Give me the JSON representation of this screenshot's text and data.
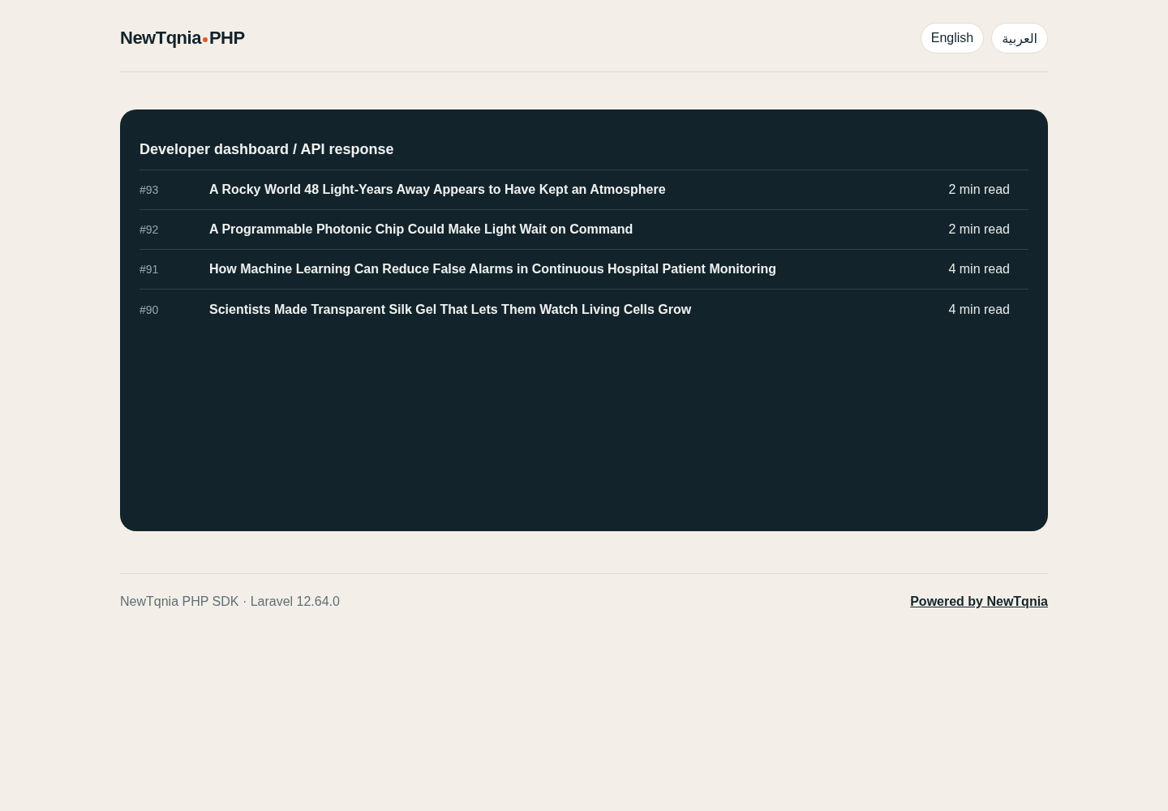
{
  "header": {
    "logo": {
      "name": "NewTqnia",
      "suffix": "PHP"
    },
    "languages": [
      {
        "label": "English"
      },
      {
        "label": "العربية"
      }
    ]
  },
  "panel": {
    "title": "Developer dashboard / API response",
    "rows": [
      {
        "id": "#93",
        "title": "A Rocky World 48 Light-Years Away Appears to Have Kept an Atmosphere",
        "read_time": "2 min read"
      },
      {
        "id": "#92",
        "title": "A Programmable Photonic Chip Could Make Light Wait on Command",
        "read_time": "2 min read"
      },
      {
        "id": "#91",
        "title": "How Machine Learning Can Reduce False Alarms in Continuous Hospital Patient Monitoring",
        "read_time": "4 min read"
      },
      {
        "id": "#90",
        "title": "Scientists Made Transparent Silk Gel That Lets Them Watch Living Cells Grow",
        "read_time": "4 min read"
      }
    ]
  },
  "footer": {
    "text": "NewTqnia PHP SDK · Laravel 12.64.0",
    "link": "Powered by NewTqnia"
  }
}
